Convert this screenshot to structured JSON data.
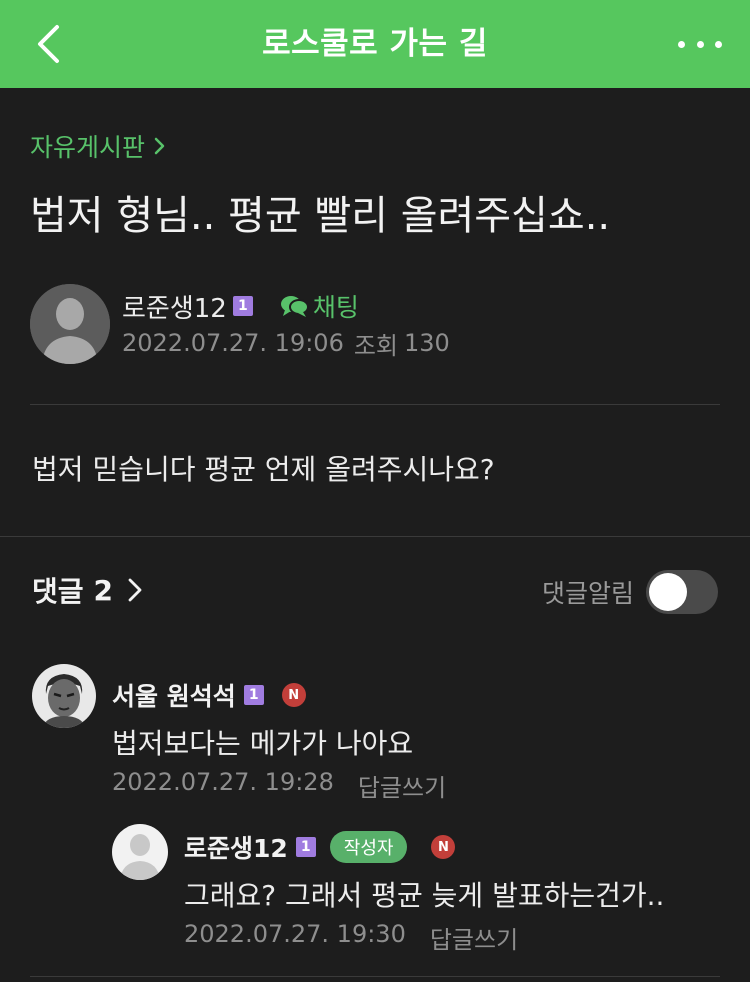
{
  "header": {
    "title": "로스쿨로 가는 길",
    "back_icon": "chevron-left-icon",
    "more_icon": "more-horizontal-icon"
  },
  "breadcrumb": {
    "label": "자유게시판"
  },
  "post": {
    "title": "법저 형님.. 평균 빨리 올려주십쇼..",
    "author": "로준생12",
    "level": "1",
    "chat_label": "채팅",
    "datetime": "2022.07.27. 19:06",
    "views_label": "조회",
    "views": "130",
    "body": "법저 믿습니다 평균 언제 올려주시나요?"
  },
  "comments_section": {
    "label": "댓글",
    "count": "2",
    "alert_label": "댓글알림",
    "alert_on": false
  },
  "comments": [
    {
      "author": "서울 원석석",
      "level": "1",
      "new_badge": "N",
      "text": "법저보다는 메가가 나아요",
      "datetime": "2022.07.27. 19:28",
      "reply_label": "답글쓰기"
    },
    {
      "author": "로준생12",
      "level": "1",
      "writer_badge": "작성자",
      "new_badge": "N",
      "text": "그래요? 그래서 평균 늦게 발표하는건가..",
      "datetime": "2022.07.27. 19:30",
      "reply_label": "답글쓰기"
    }
  ],
  "colors": {
    "header_bg": "#56c75e",
    "page_bg": "#1d1d1d",
    "accent_green": "#58c26a",
    "level_badge": "#a07ce0",
    "new_badge": "#c23f3a"
  }
}
